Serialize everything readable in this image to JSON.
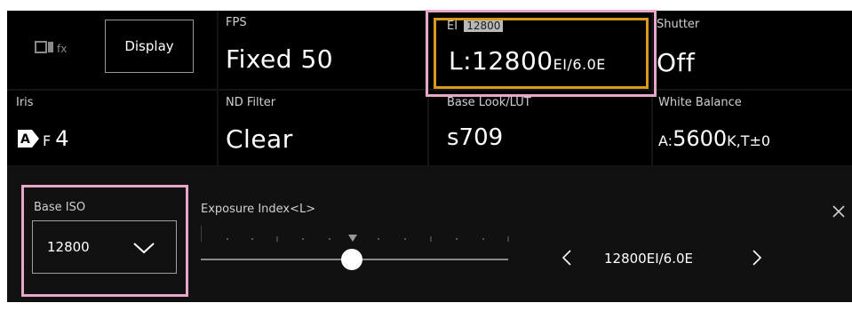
{
  "toolbar": {
    "logo_icon": "camera-fx-icon",
    "display_label": "Display"
  },
  "fps": {
    "caption": "FPS",
    "value": "Fixed 50"
  },
  "ei": {
    "caption": "EI",
    "badge": "12800",
    "value_main": "L:12800",
    "value_unit": "EI/6.0E"
  },
  "shutter": {
    "caption": "Shutter",
    "value": "Off"
  },
  "iris": {
    "caption": "Iris",
    "auto_icon": "auto-A-icon",
    "auto_glyph": "A",
    "value_prefix": "F",
    "value": "4"
  },
  "nd_filter": {
    "caption": "ND Filter",
    "value": "Clear"
  },
  "base_look": {
    "caption": "Base Look/LUT",
    "value": "s709"
  },
  "white_balance": {
    "caption": "White Balance",
    "prefix": "A:",
    "kelvin": "5600",
    "kelvin_unit": "K,",
    "tint": "T±0"
  },
  "base_iso": {
    "caption": "Base ISO",
    "value": "12800"
  },
  "exposure_index": {
    "caption": "Exposure Index<L>",
    "value": "12800EI/6.0E",
    "slider_position_fraction": 0.49
  },
  "colors": {
    "highlight_pink": "#e8a6c8",
    "selected_orange": "#d99a1c",
    "panel_bg": "#141414",
    "cell_bg": "#000000"
  }
}
